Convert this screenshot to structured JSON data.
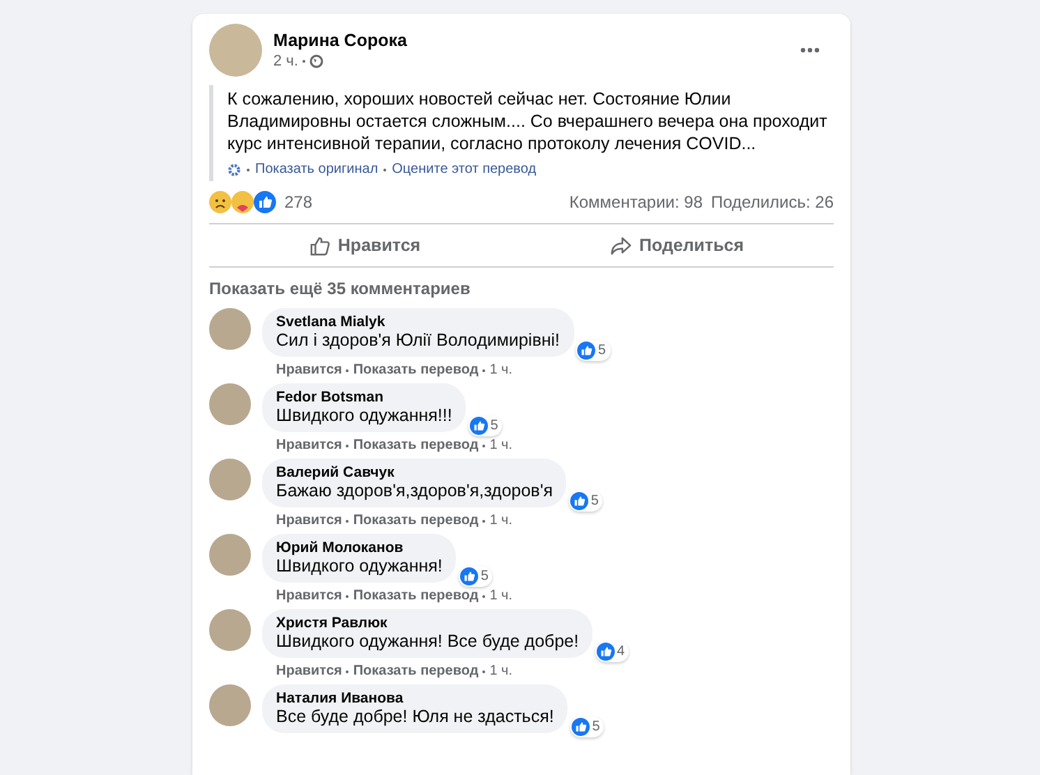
{
  "post": {
    "author": "Марина Сорока",
    "time": "2 ч.",
    "text": "К сожалению, хороших новостей сейчас нет. Состояние Юлии Владимировны остается сложным.... Со вчерашнего вечера она проходит курс интенсивной терапии, согласно протоколу лечения COVID...",
    "translation_links": [
      "Показать оригинал",
      "Оцените этот перевод"
    ],
    "reactions_count": "278",
    "comments_count": "Комментарии: 98",
    "shares_count": "Поделились: 26"
  },
  "actions": [
    {
      "kind": "like",
      "label": "Нравится"
    },
    {
      "kind": "share",
      "label": "Поделиться"
    }
  ],
  "more_comments": "Показать ещё 35 комментариев",
  "comments": [
    {
      "author": "Svetlana Mialyk",
      "text": "Сил і здоров'я Юлії Володимирівні!",
      "likes": "5",
      "actions": [
        "Нравится",
        "Показать перевод",
        "1 ч."
      ]
    },
    {
      "author": "Fedor Botsman",
      "text": "Швидкого одужання!!!",
      "likes": "5",
      "actions": [
        "Нравится",
        "Показать перевод",
        "1 ч."
      ]
    },
    {
      "author": "Валерий Савчук",
      "text": "Бажаю здоров'я,здоров'я,здоров'я",
      "likes": "5",
      "actions": [
        "Нравится",
        "Показать перевод",
        "1 ч."
      ]
    },
    {
      "author": "Юрий Молоканов",
      "text": "Швидкого одужання!",
      "likes": "5",
      "actions": [
        "Нравится",
        "Показать перевод",
        "1 ч."
      ]
    },
    {
      "author": "Христя Равлюк",
      "text": "Швидкого одужання! Все буде добре!",
      "likes": "4",
      "actions": [
        "Нравится",
        "Показать перевод",
        "1 ч."
      ]
    },
    {
      "author": "Наталия Иванова",
      "text": "Все буде добре! Юля не здасться!",
      "likes": "5"
    }
  ]
}
